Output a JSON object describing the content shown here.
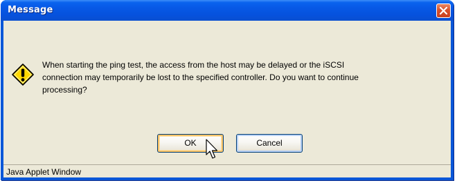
{
  "window": {
    "title": "Message",
    "close_icon": "close-icon"
  },
  "dialog": {
    "icon": "warning-icon",
    "message_lines": [
      "When starting the ping test, the access from the host may be delayed or the iSCSI",
      "connection may temporarily be lost to the specified controller. Do you want to continue",
      "processing?"
    ],
    "ok_label": "OK",
    "cancel_label": "Cancel"
  },
  "status_bar": {
    "text": "Java Applet Window"
  },
  "colors": {
    "titlebar": "#0a58e0",
    "dialog_bg": "#ece9d8",
    "close_button": "#d8502a",
    "warning_fill": "#ffd800"
  }
}
